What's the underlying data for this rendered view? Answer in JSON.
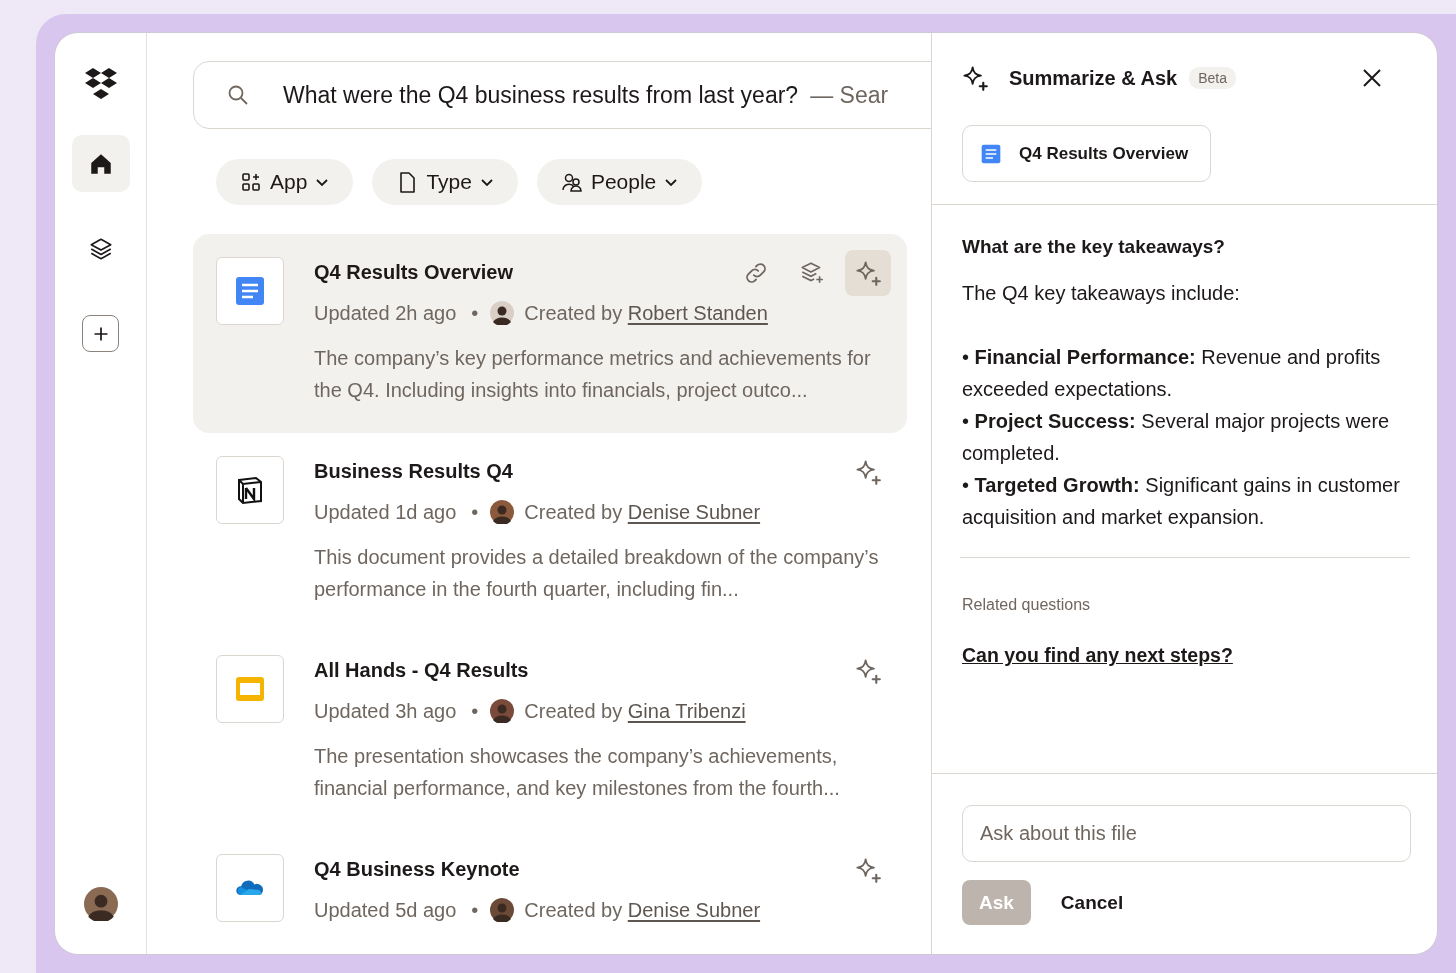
{
  "sidebar": {
    "nav": [
      {
        "kind": "home",
        "selected": true
      },
      {
        "kind": "layers",
        "selected": false
      },
      {
        "kind": "add",
        "selected": false
      }
    ]
  },
  "search": {
    "value": "What were the Q4 business results from last year?",
    "suffix": "— Sear"
  },
  "filters": [
    {
      "kind": "app",
      "label": "App"
    },
    {
      "kind": "type",
      "label": "Type"
    },
    {
      "kind": "people",
      "label": "People"
    }
  ],
  "results": [
    {
      "kind": "docs",
      "title": "Q4 Results Overview",
      "updated": "Updated 2h ago",
      "separator": "•",
      "created_prefix": "Created by",
      "author": "Robert Standen",
      "description": "The company’s key performance metrics and achievements for the Q4. Including insights into financials, project outco...",
      "selected": true
    },
    {
      "kind": "notion",
      "title": "Business Results Q4",
      "updated": "Updated 1d ago",
      "separator": "•",
      "created_prefix": "Created by",
      "author": "Denise Subner",
      "description": "This document provides a detailed breakdown of the company’s performance in the fourth quarter, including fin...",
      "selected": false
    },
    {
      "kind": "slides",
      "title": "All Hands - Q4 Results",
      "updated": "Updated 3h ago",
      "separator": "•",
      "created_prefix": "Created by",
      "author": "Gina Tribenzi",
      "description": "The presentation showcases the company’s achievements, financial performance, and key milestones from the fourth...",
      "selected": false
    },
    {
      "kind": "onedrive",
      "title": "Q4 Business Keynote",
      "updated": "Updated 5d ago",
      "separator": "•",
      "created_prefix": "Created by",
      "author": "Denise Subner",
      "selected": false
    }
  ],
  "panel": {
    "title": "Summarize & Ask",
    "badge": "Beta",
    "file": {
      "kind": "docs",
      "name": "Q4 Results Overview"
    },
    "question": "What are the key takeaways?",
    "answer_intro": "The Q4 key takeaways include:",
    "points": [
      "• **Financial Performance:** Revenue and profits exceeded expectations.",
      "• **Project Success:** Several major projects were completed.",
      "• **Targeted Growth:** Significant gains in customer acquisition and market expansion."
    ],
    "related_heading": "Related questions",
    "related": [
      "Can you find any next steps?"
    ],
    "input": {
      "placeholder": "Ask about this file"
    },
    "ask_button": {
      "label": "Ask",
      "disabled": true
    },
    "cancel_button": "Cancel"
  }
}
